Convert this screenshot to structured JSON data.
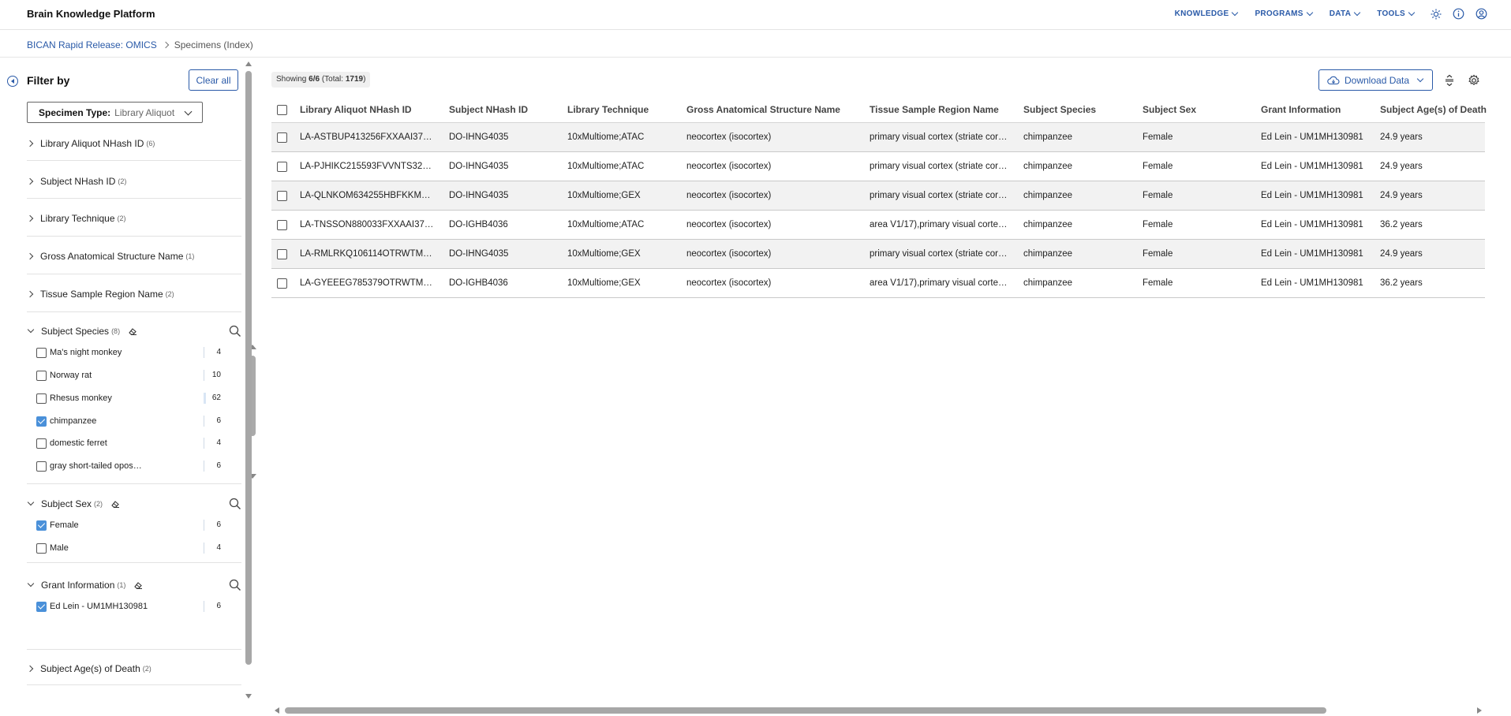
{
  "app": {
    "brand": "Brain Knowledge Platform",
    "nav": [
      "KNOWLEDGE",
      "PROGRAMS",
      "DATA",
      "TOOLS"
    ],
    "icons": [
      "sun-icon",
      "info-icon",
      "user-icon"
    ]
  },
  "breadcrumb": {
    "parent": "BICAN Rapid Release: OMICS",
    "current": "Specimens (Index)"
  },
  "sidebar": {
    "title": "Filter by",
    "clear_all": "Clear all",
    "specimen_type_label": "Specimen Type:",
    "specimen_type_value": "Library Aliquot",
    "collapsed_facets": [
      {
        "label": "Library Aliquot NHash ID",
        "count": "(6)"
      },
      {
        "label": "Subject NHash ID",
        "count": "(2)"
      },
      {
        "label": "Library Technique",
        "count": "(2)"
      },
      {
        "label": "Gross Anatomical Structure Name",
        "count": "(1)"
      },
      {
        "label": "Tissue Sample Region Name",
        "count": "(2)"
      }
    ],
    "species": {
      "label": "Subject Species",
      "count": "(8)",
      "options": [
        {
          "label": "Ma's night monkey",
          "count": "4",
          "checked": false
        },
        {
          "label": "Norway rat",
          "count": "10",
          "checked": false
        },
        {
          "label": "Rhesus monkey",
          "count": "62",
          "checked": false
        },
        {
          "label": "chimpanzee",
          "count": "6",
          "checked": true
        },
        {
          "label": "domestic ferret",
          "count": "4",
          "checked": false
        },
        {
          "label": "gray short-tailed opos…",
          "count": "6",
          "checked": false
        }
      ]
    },
    "sex": {
      "label": "Subject Sex",
      "count": "(2)",
      "options": [
        {
          "label": "Female",
          "count": "6",
          "checked": true
        },
        {
          "label": "Male",
          "count": "4",
          "checked": false
        }
      ]
    },
    "grant": {
      "label": "Grant Information",
      "count": "(1)",
      "options": [
        {
          "label": "Ed Lein - UM1MH130981",
          "count": "6",
          "checked": true
        }
      ]
    },
    "age": {
      "label": "Subject Age(s) of Death",
      "count": "(2)"
    }
  },
  "main": {
    "showing_prefix": "Showing ",
    "showing_value": "6/6",
    "showing_total_prefix": " (Total: ",
    "showing_total": "1719",
    "showing_suffix": ")",
    "download_label": "Download Data",
    "columns": [
      "Library Aliquot NHash ID",
      "Subject NHash ID",
      "Library Technique",
      "Gross Anatomical Structure Name",
      "Tissue Sample Region Name",
      "Subject Species",
      "Subject Sex",
      "Grant Information",
      "Subject Age(s) of Death"
    ],
    "rows": [
      [
        "LA-ASTBUP413256FXXAAI37…",
        "DO-IHNG4035",
        "10xMultiome;ATAC",
        "neocortex (isocortex)",
        "primary visual cortex (striate cor…",
        "chimpanzee",
        "Female",
        "Ed Lein - UM1MH130981",
        "24.9 years"
      ],
      [
        "LA-PJHIKC215593FVVNTS32…",
        "DO-IHNG4035",
        "10xMultiome;ATAC",
        "neocortex (isocortex)",
        "primary visual cortex (striate cor…",
        "chimpanzee",
        "Female",
        "Ed Lein - UM1MH130981",
        "24.9 years"
      ],
      [
        "LA-QLNKOM634255HBFKKM…",
        "DO-IHNG4035",
        "10xMultiome;GEX",
        "neocortex (isocortex)",
        "primary visual cortex (striate cor…",
        "chimpanzee",
        "Female",
        "Ed Lein - UM1MH130981",
        "24.9 years"
      ],
      [
        "LA-TNSSON880033FXXAAI37…",
        "DO-IGHB4036",
        "10xMultiome;ATAC",
        "neocortex (isocortex)",
        "area V1/17),primary visual corte…",
        "chimpanzee",
        "Female",
        "Ed Lein - UM1MH130981",
        "36.2 years"
      ],
      [
        "LA-RMLRKQ106114OTRWTM…",
        "DO-IHNG4035",
        "10xMultiome;GEX",
        "neocortex (isocortex)",
        "primary visual cortex (striate cor…",
        "chimpanzee",
        "Female",
        "Ed Lein - UM1MH130981",
        "24.9 years"
      ],
      [
        "LA-GYEEEG785379OTRWTM…",
        "DO-IGHB4036",
        "10xMultiome;GEX",
        "neocortex (isocortex)",
        "area V1/17),primary visual corte…",
        "chimpanzee",
        "Female",
        "Ed Lein - UM1MH130981",
        "36.2 years"
      ]
    ]
  },
  "colors": {
    "accent": "#2a5aa8",
    "checkbox": "#4a90d9",
    "row_alt": "#f2f2f2"
  }
}
